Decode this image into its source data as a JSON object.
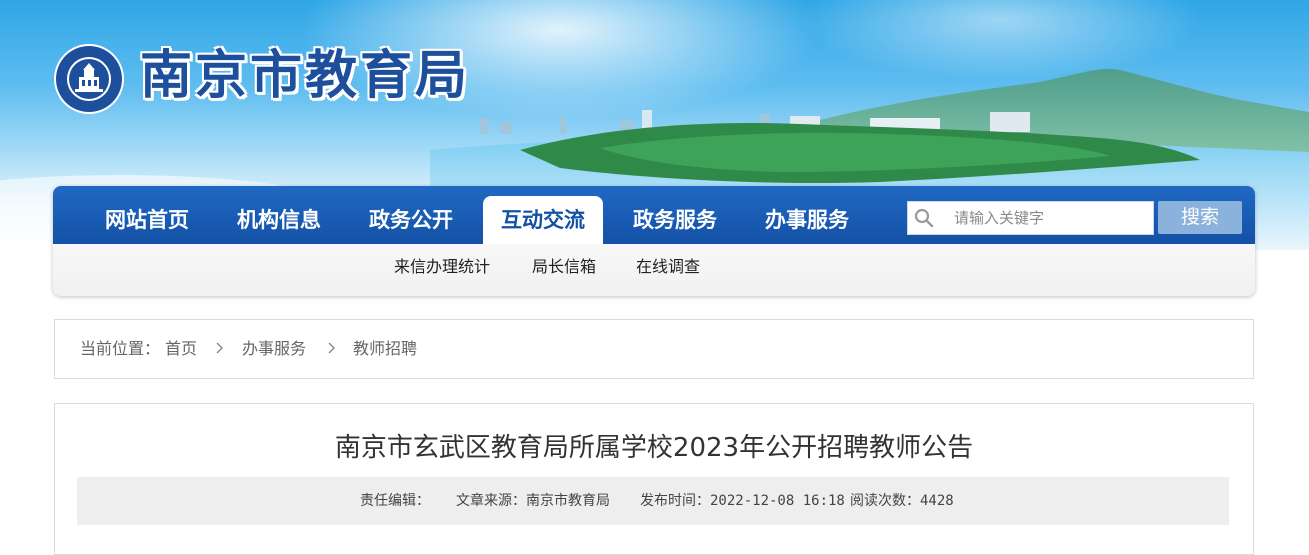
{
  "header": {
    "site_title": "南京市教育局"
  },
  "nav": {
    "items": [
      {
        "label": "网站首页"
      },
      {
        "label": "机构信息"
      },
      {
        "label": "政务公开"
      },
      {
        "label": "互动交流",
        "active": true
      },
      {
        "label": "政务服务"
      },
      {
        "label": "办事服务"
      }
    ],
    "sub_items": [
      {
        "label": "来信办理统计"
      },
      {
        "label": "局长信箱"
      },
      {
        "label": "在线调查"
      }
    ],
    "search": {
      "placeholder": "请输入关键字",
      "value": "",
      "button_label": "搜索",
      "icon": "search-icon"
    }
  },
  "breadcrumb": {
    "prefix": "当前位置：",
    "items": [
      "首页",
      "办事服务",
      "教师招聘"
    ],
    "separator_icon": "chevron-right-icon"
  },
  "article": {
    "title": "南京市玄武区教育局所属学校2023年公开招聘教师公告",
    "meta": {
      "editor_label": "责任编辑：",
      "editor_value": "",
      "source_label": "文章来源：",
      "source_value": "南京市教育局",
      "published_label": "发布时间：",
      "published_value": "2022-12-08 16:18",
      "views_label": "阅读次数：",
      "views_value": "4428"
    }
  },
  "colors": {
    "nav_blue": "#1451a6",
    "title_blue": "#1d4f9c",
    "search_button": "#8ab2dc",
    "meta_bar_bg": "#eeeeee"
  }
}
